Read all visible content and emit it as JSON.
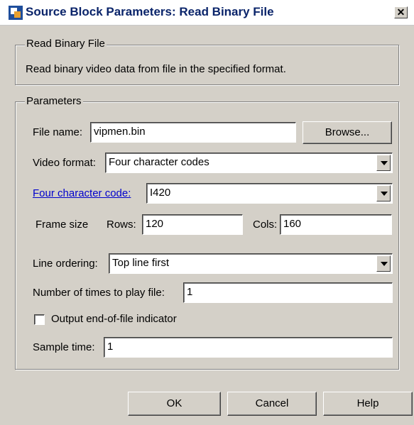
{
  "window": {
    "title": "Source Block Parameters: Read Binary File",
    "close_glyph": "✕"
  },
  "description_group": {
    "legend": "Read Binary File",
    "text": "Read binary video data from file in the specified format."
  },
  "parameters_group": {
    "legend": "Parameters",
    "file_name": {
      "label": "File name:",
      "value": "vipmen.bin",
      "browse_label": "Browse..."
    },
    "video_format": {
      "label": "Video format:",
      "value": "Four character codes"
    },
    "four_cc": {
      "label": "Four character code:",
      "value": "I420"
    },
    "frame_size": {
      "label": "Frame size",
      "rows_label": "Rows:",
      "rows_value": "120",
      "cols_label": "Cols:",
      "cols_value": "160"
    },
    "line_ordering": {
      "label": "Line ordering:",
      "value": "Top line first"
    },
    "play_times": {
      "label": "Number of times to play file:",
      "value": "1"
    },
    "eof_indicator": {
      "label": "Output end-of-file indicator",
      "checked": false
    },
    "sample_time": {
      "label": "Sample time:",
      "value": "1"
    }
  },
  "buttons": {
    "ok": "OK",
    "cancel": "Cancel",
    "help": "Help"
  },
  "colors": {
    "dialog_bg": "#d4d0c8",
    "title_text": "#0a246a",
    "link": "#0000cc"
  }
}
